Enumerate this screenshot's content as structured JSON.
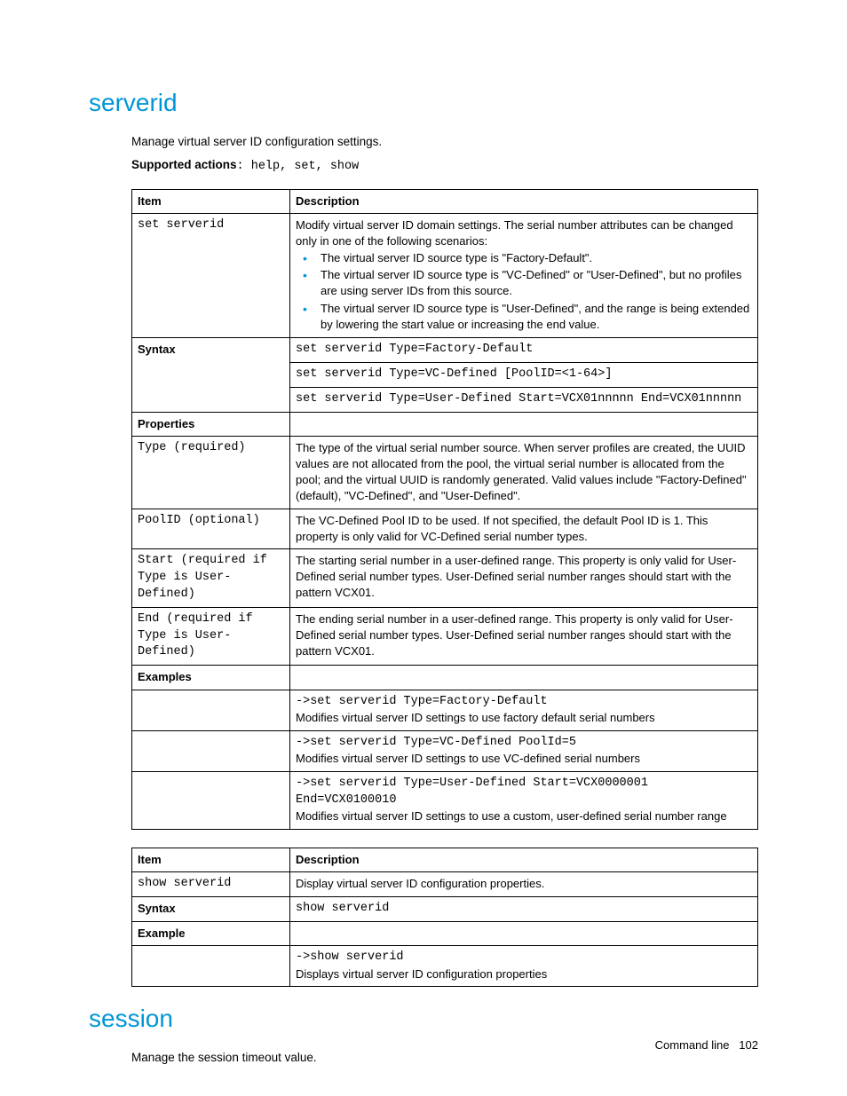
{
  "serverid": {
    "heading": "serverid",
    "manage_text": "Manage virtual server ID configuration settings.",
    "supported_label": "Supported actions",
    "supported_actions": ": help, set, show",
    "table1": {
      "head_item": "Item",
      "head_desc": "Description",
      "rows": {
        "set_cmd": "set serverid",
        "set_desc_intro": "Modify virtual server ID domain settings. The serial number attributes can be changed only in one of the following scenarios:",
        "bullet1": "The virtual server ID source type is \"Factory-Default\".",
        "bullet2": "The virtual server ID source type is \"VC-Defined\" or \"User-Defined\", but no profiles are using server IDs from this source.",
        "bullet3": "The virtual server ID source type is \"User-Defined\", and the range is being extended by lowering the start value or increasing the end value.",
        "syntax_label": "Syntax",
        "syntax1": "set serverid Type=Factory-Default",
        "syntax2": "set serverid Type=VC-Defined [PoolID=<1-64>]",
        "syntax3": "set serverid Type=User-Defined Start=VCX01nnnnn End=VCX01nnnnn",
        "properties_label": "Properties",
        "type_label": "Type (required)",
        "type_desc": "The type of the virtual serial number source. When server profiles are created, the UUID values are not allocated from the pool, the virtual serial number is allocated from the pool; and the virtual UUID is randomly generated. Valid values include \"Factory-Defined\" (default), \"VC-Defined\", and \"User-Defined\".",
        "poolid_label": "PoolID (optional)",
        "poolid_desc": "The VC-Defined Pool ID to be used. If not specified, the default Pool ID is 1. This property is only valid for VC-Defined serial number types.",
        "start_label": "Start (required if Type is\nUser-Defined)",
        "start_desc": "The starting serial number in a user-defined range. This property is only valid for User-Defined serial number types. User-Defined serial number ranges should start with the pattern VCX01.",
        "end_label": "End (required if Type is User-Defined)",
        "end_desc": "The ending serial number in a user-defined range. This property is only valid for User-Defined serial number types. User-Defined serial number ranges should start with the pattern VCX01.",
        "examples_label": "Examples",
        "ex1_cmd": "->set serverid Type=Factory-Default",
        "ex1_desc": "Modifies virtual server ID settings to use factory default serial numbers",
        "ex2_cmd": "->set serverid Type=VC-Defined PoolId=5",
        "ex2_desc": "Modifies virtual server ID settings to use VC-defined serial numbers",
        "ex3_cmd": "->set serverid Type=User-Defined Start=VCX0000001 End=VCX0100010",
        "ex3_desc": "Modifies virtual server ID settings to use a custom, user-defined serial number range"
      }
    },
    "table2": {
      "head_item": "Item",
      "head_desc": "Description",
      "show_cmd": "show serverid",
      "show_desc": "Display virtual server ID configuration properties.",
      "syntax_label": "Syntax",
      "syntax_cmd": "show serverid",
      "example_label": "Example",
      "ex_cmd": "->show serverid",
      "ex_desc": "Displays virtual server ID configuration properties"
    }
  },
  "session": {
    "heading": "session",
    "manage_text": "Manage the session timeout value."
  },
  "footer": {
    "section": "Command line",
    "page": "102"
  }
}
